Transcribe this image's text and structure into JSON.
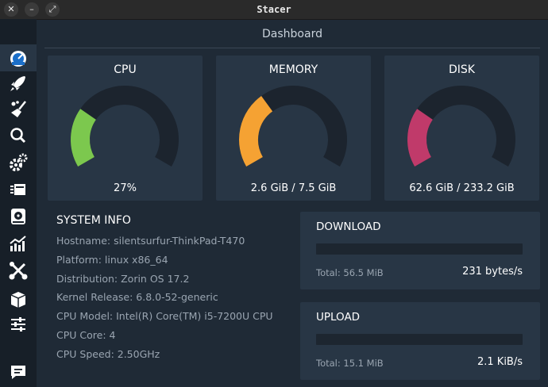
{
  "window": {
    "title": "Stacer",
    "buttons": [
      "close-icon",
      "minimize-icon",
      "maximize-icon"
    ]
  },
  "sidebar": {
    "items": [
      {
        "name": "dashboard",
        "icon": "speedometer-icon",
        "active": true
      },
      {
        "name": "startup-apps",
        "icon": "rocket-icon",
        "active": false
      },
      {
        "name": "system-cleaner",
        "icon": "broom-icon",
        "active": false
      },
      {
        "name": "search",
        "icon": "search-icon",
        "active": false
      },
      {
        "name": "services",
        "icon": "gears-icon",
        "active": false
      },
      {
        "name": "processes",
        "icon": "list-icon",
        "active": false
      },
      {
        "name": "uninstaller",
        "icon": "disk-icon",
        "active": false
      },
      {
        "name": "resources",
        "icon": "chart-icon",
        "active": false
      },
      {
        "name": "helpers",
        "icon": "tools-icon",
        "active": false
      },
      {
        "name": "apt-repository",
        "icon": "box-icon",
        "active": false
      },
      {
        "name": "settings",
        "icon": "sliders-icon",
        "active": false
      },
      {
        "name": "feedback",
        "icon": "chat-icon",
        "active": false
      }
    ]
  },
  "header": {
    "title": "Dashboard"
  },
  "gauges": [
    {
      "label": "CPU",
      "value": "27%",
      "percent": 27,
      "color": "#7cc84e"
    },
    {
      "label": "MEMORY",
      "value": "2.6 GiB / 7.5 GiB",
      "percent": 35,
      "color": "#f5a233"
    },
    {
      "label": "DISK",
      "value": "62.6 GiB / 233.2 GiB",
      "percent": 27,
      "color": "#c03a6a"
    }
  ],
  "system_info": {
    "title": "SYSTEM INFO",
    "rows": [
      "Hostname: silentsurfur-ThinkPad-T470",
      "Platform: linux x86_64",
      "Distribution: Zorin OS 17.2",
      "Kernel Release: 6.8.0-52-generic",
      "CPU Model: Intel(R) Core(TM) i5-7200U CPU",
      "CPU Core: 4",
      "CPU Speed: 2.50GHz"
    ]
  },
  "network": {
    "download": {
      "label": "DOWNLOAD",
      "total": "Total: 56.5 MiB",
      "rate": "231 bytes/s",
      "percent": 0
    },
    "upload": {
      "label": "UPLOAD",
      "total": "Total: 15.1 MiB",
      "rate": "2.1 KiB/s",
      "percent": 0
    }
  },
  "colors": {
    "background": "#1f2a36",
    "card": "#283645",
    "gauge_track": "#1c242e",
    "accent": "#3d8bd8"
  }
}
